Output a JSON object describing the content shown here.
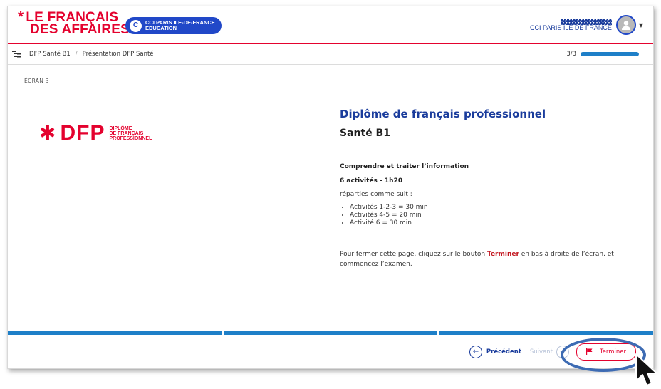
{
  "header": {
    "logo_line1_prefix": "*",
    "logo_line1": "LE FRANÇAIS",
    "logo_line2": "DES AFFAIRES",
    "cci_badge_line1": "CCI PARIS ILE-DE-FRANCE",
    "cci_badge_line2": "EDUCATION",
    "user_org": "CCI PARIS ILE DE FRANCE"
  },
  "breadcrumb": {
    "items": [
      "DFP Santé B1",
      "Présentation DFP Santé"
    ],
    "separator": "/"
  },
  "progress": {
    "label": "3/3",
    "fraction": 1.0
  },
  "content": {
    "screen_label": "ÉCRAN 3",
    "dfp_logo": {
      "mark": "DFP",
      "sub_line1": "DIPLÔME",
      "sub_line2": "DE FRANÇAIS",
      "sub_line3": "PROFESSIONNEL"
    },
    "title": "Diplôme de français professionnel",
    "subtitle": "Santé B1",
    "section_title": "Comprendre et traiter l’information",
    "activities_summary": "6 activités - 1h20",
    "split_intro": "réparties comme suit :",
    "activities": [
      "Activités 1-2-3 = 30 min",
      "Activités 4-5 = 20 min",
      "Activité 6 = 30 min"
    ],
    "closing_before": "Pour fermer cette page, cliquez sur le bouton ",
    "closing_button_word": "Terminer",
    "closing_after": " en bas à droite de l’écran, et commencez l’examen."
  },
  "footer": {
    "prev_label": "Précédent",
    "next_label": "Suivant",
    "finish_label": "Terminer"
  },
  "colors": {
    "brand_blue": "#1a3c9c",
    "brand_red": "#e4022e",
    "progress_blue": "#1e7fc8"
  }
}
